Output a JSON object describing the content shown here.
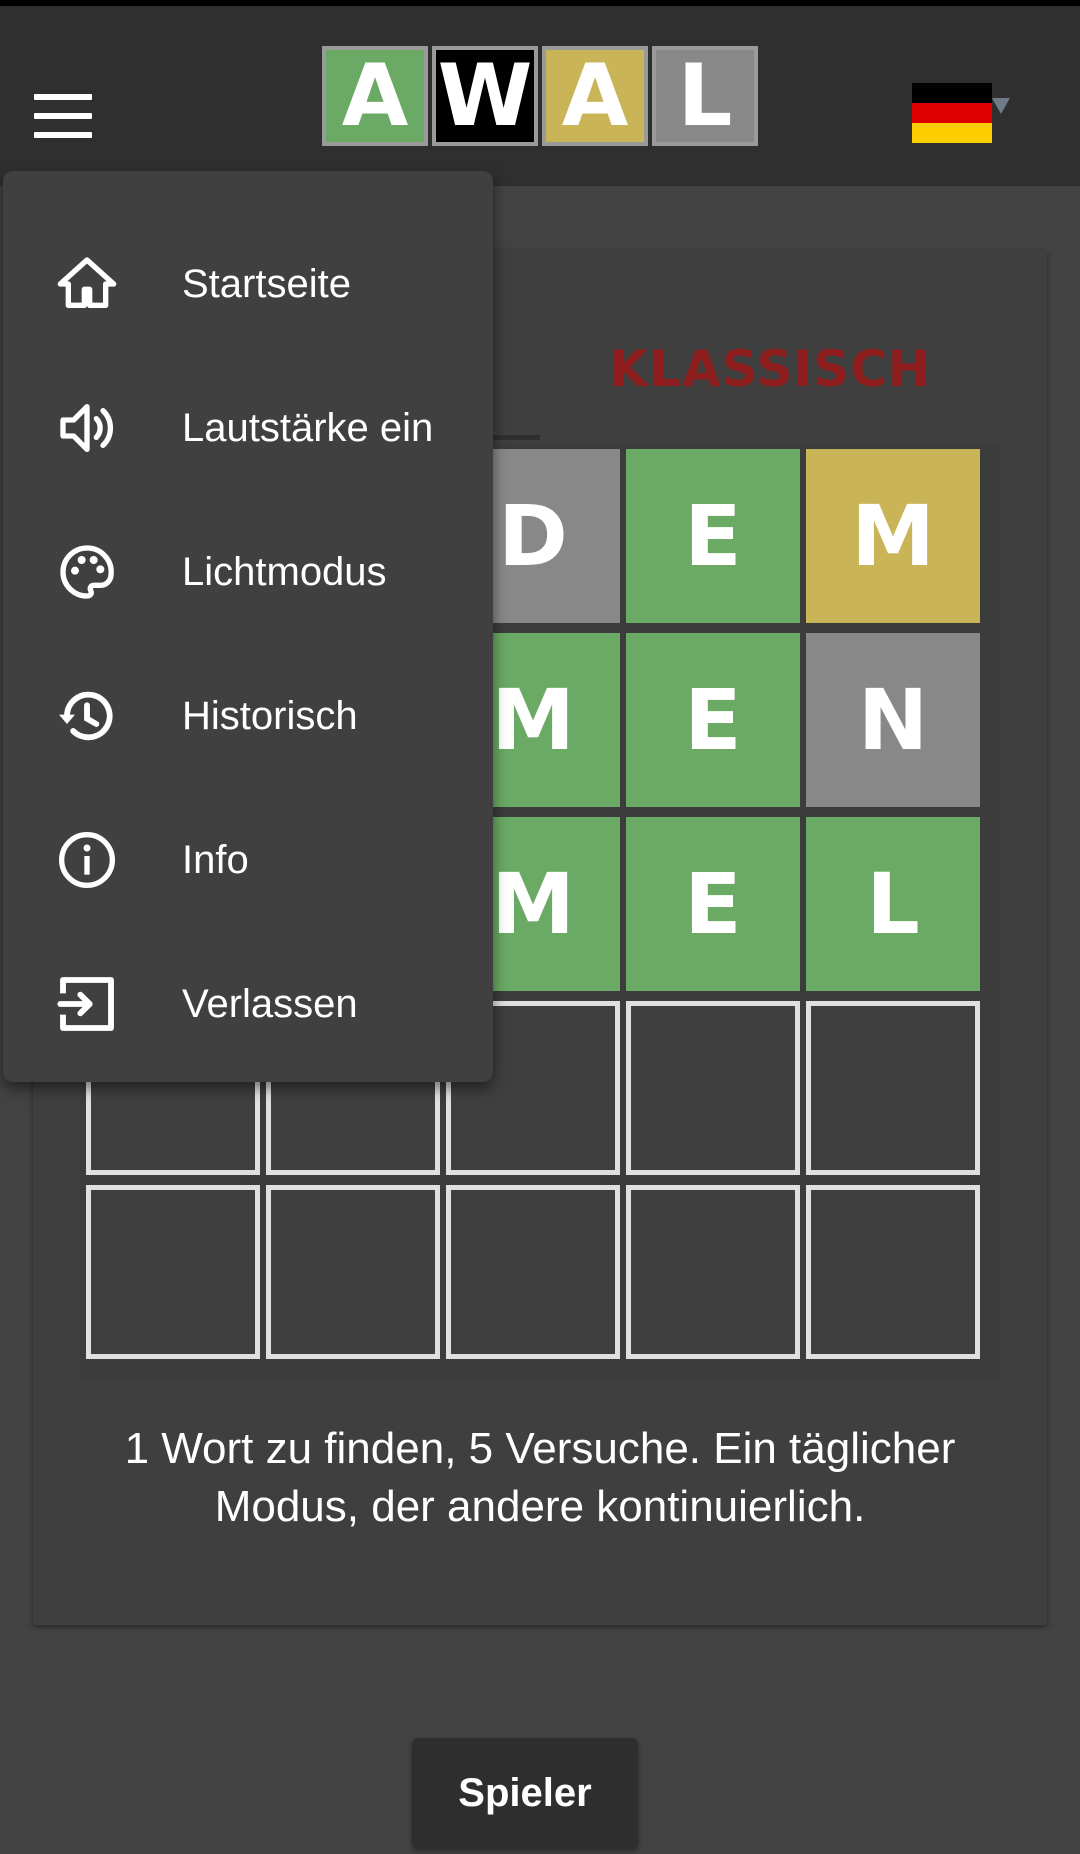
{
  "logo": {
    "letters": [
      "A",
      "W",
      "A",
      "L"
    ],
    "colors": [
      "#6aaa64",
      "#000000",
      "#c9b458",
      "#888888"
    ]
  },
  "flag": {
    "name": "germany-flag",
    "colors": [
      "#000000",
      "#dd0000",
      "#ffce00"
    ]
  },
  "tab": {
    "classic_label": "KLASSISCH"
  },
  "board": {
    "rows": [
      [
        {
          "l": "",
          "s": "hidden"
        },
        {
          "l": "",
          "s": "hidden"
        },
        {
          "l": "D",
          "s": "x"
        },
        {
          "l": "E",
          "s": "g"
        },
        {
          "l": "M",
          "s": "y"
        }
      ],
      [
        {
          "l": "",
          "s": "hidden"
        },
        {
          "l": "",
          "s": "hidden"
        },
        {
          "l": "M",
          "s": "g"
        },
        {
          "l": "E",
          "s": "g"
        },
        {
          "l": "N",
          "s": "x"
        }
      ],
      [
        {
          "l": "",
          "s": "hidden"
        },
        {
          "l": "",
          "s": "hidden"
        },
        {
          "l": "M",
          "s": "g"
        },
        {
          "l": "E",
          "s": "g"
        },
        {
          "l": "L",
          "s": "g"
        }
      ],
      [
        {
          "l": "",
          "s": "empty"
        },
        {
          "l": "",
          "s": "empty"
        },
        {
          "l": "",
          "s": "empty"
        },
        {
          "l": "",
          "s": "empty"
        },
        {
          "l": "",
          "s": "empty"
        }
      ],
      [
        {
          "l": "",
          "s": "empty"
        },
        {
          "l": "",
          "s": "empty"
        },
        {
          "l": "",
          "s": "empty"
        },
        {
          "l": "",
          "s": "empty"
        },
        {
          "l": "",
          "s": "empty"
        }
      ]
    ]
  },
  "description": "1 Wort zu finden, 5 Versuche. Ein täglicher Modus, der andere kontinuierlich.",
  "play_button": "Spieler",
  "menu": {
    "items": [
      {
        "label": "Startseite",
        "icon": "home-icon"
      },
      {
        "label": "Lautstärke ein",
        "icon": "volume-icon"
      },
      {
        "label": "Lichtmodus",
        "icon": "palette-icon"
      },
      {
        "label": "Historisch",
        "icon": "history-icon"
      },
      {
        "label": "Info",
        "icon": "info-icon"
      },
      {
        "label": "Verlassen",
        "icon": "exit-icon"
      }
    ]
  }
}
